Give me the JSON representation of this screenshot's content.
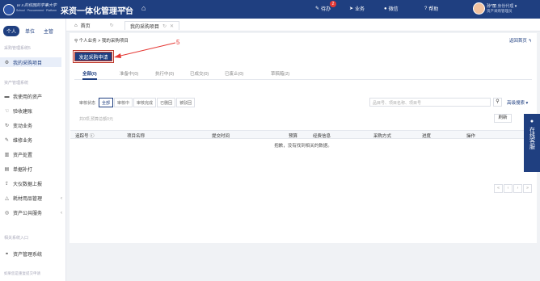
{
  "header": {
    "school": "ｗｘ的校园的学事大学",
    "school_sub": "School · Procurement · Platform",
    "app_title": "采资一体化管理平台",
    "nav": {
      "todo": "待办",
      "todo_count": "2",
      "business": "业务",
      "wechat": "微信",
      "help": "帮助"
    },
    "user": {
      "name": "孙*丽",
      "role": "身份代理",
      "dept": "资产采购管理员"
    }
  },
  "sidebar": {
    "tabs": [
      "个人",
      "单位",
      "主管"
    ],
    "group1": "采购管理系统5",
    "item_active": "我的采购项目",
    "group2": "资产管理系统",
    "items": [
      "我使用的资产",
      "验收建账",
      "变动业务",
      "维修业务",
      "资产处置",
      "单据补打",
      "大仪数据上报",
      "耗材用品管理",
      "资产公共服务"
    ],
    "group3": "相关系统入口",
    "entry": "资产管理系统",
    "footer": "如果您是重复提交申请"
  },
  "page_tabs": {
    "home": "首页",
    "current": "我的采购项目"
  },
  "breadcrumb": {
    "a": "个人业务",
    "sep": ">",
    "b": "我的采购项目"
  },
  "back_label": "返回首页",
  "launch_label": "发起采购申请",
  "annotation": "5",
  "filter_tabs": [
    "全部(0)",
    "准备中(0)",
    "执行中(0)",
    "已成交(0)",
    "已废止(0)",
    "草稿箱(2)"
  ],
  "status_filter": {
    "label": "审核状态",
    "options": [
      "全部",
      "审核中",
      "审核完成",
      "已删回",
      "被驳回"
    ]
  },
  "search": {
    "placeholder": "品目号、项目名称、项目号",
    "advanced": "高级搜索"
  },
  "summary": "共0项,预算总额0元",
  "refresh_label": "刷新",
  "table": {
    "headers": [
      "追踪号",
      "项目名称",
      "提交时间",
      "预算",
      "经费信息",
      "采购方式",
      "进度",
      "操作"
    ],
    "empty": "抱歉，没有找到相关的数据。"
  },
  "service": "在线客服"
}
